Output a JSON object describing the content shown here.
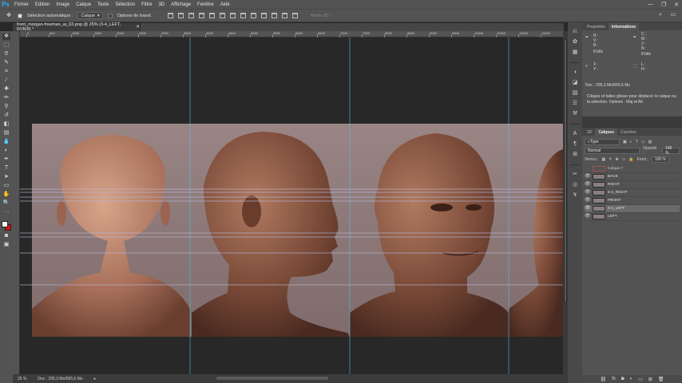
{
  "app": {
    "logo": "Ps"
  },
  "menu": [
    "Fichier",
    "Edition",
    "Image",
    "Calque",
    "Texte",
    "Sélection",
    "Filtre",
    "3D",
    "Affichage",
    "Fenêtre",
    "Aide"
  ],
  "window_controls": {
    "minimize": "—",
    "restore": "❐",
    "close": "✕"
  },
  "options_bar": {
    "auto_select_label": "Sélection automatique :",
    "auto_select_value": "Calque",
    "transform_label": "Options de transf.",
    "mode_3d_label": "Mode 3D :"
  },
  "document": {
    "tab_title": "front_morgan-freeman_ai_03.png @ 25% (3-4_LEFT, RVB/8) *",
    "zoom": "25 %",
    "doc_size": "Doc : 295,3 Mo/665,6 Mo"
  },
  "ruler_ticks": [
    "0",
    "500",
    "1000",
    "1500",
    "2000",
    "2500",
    "3000",
    "3500",
    "4000",
    "4500",
    "5000",
    "5500",
    "6000",
    "6500",
    "7000",
    "7500",
    "8000",
    "8500",
    "9000",
    "9500",
    "10000",
    "10500",
    "11000",
    "11500"
  ],
  "panels": {
    "top_tabs": [
      "Propriétés",
      "Informations"
    ],
    "info": {
      "r": "R :",
      "g": "V :",
      "b": "B :",
      "c": "C :",
      "m": "M :",
      "y": "J :",
      "k": "N :",
      "bits1": "8 bits",
      "bits2": "8 bits",
      "x": "X :",
      "y_coord": "Y :",
      "l": "L :",
      "h": "H :",
      "doc": "Doc : 295,3 Mo/665,6 Mo",
      "hint": "Cliquez et faites glisser pour déplacer le calque ou la sélection. Options : Maj et Alt."
    },
    "bottom_tabs": [
      "3D",
      "Calques",
      "Couches"
    ],
    "layers": {
      "filter": "Type",
      "blend_mode": "Normal",
      "opacity_label": "Opacité :",
      "opacity_value": "100 %",
      "lock_label": "Verrou :",
      "fill_label": "Fond :",
      "fill_value": "100 %",
      "items": [
        {
          "name": "Calque 7",
          "visible": false,
          "selected": false
        },
        {
          "name": "BACK",
          "visible": true,
          "selected": false
        },
        {
          "name": "RIGHT",
          "visible": true,
          "selected": false
        },
        {
          "name": "3-4_RIGHT",
          "visible": true,
          "selected": false
        },
        {
          "name": "FRONT",
          "visible": true,
          "selected": false
        },
        {
          "name": "3-4_LEFT",
          "visible": true,
          "selected": true
        },
        {
          "name": "LEFT",
          "visible": true,
          "selected": false
        }
      ]
    }
  },
  "colors": {
    "foreground": "#ffffff",
    "background": "#e01010",
    "app_bg": "#535353",
    "canvas_bg": "#282828",
    "guide": "#49c6e5"
  }
}
